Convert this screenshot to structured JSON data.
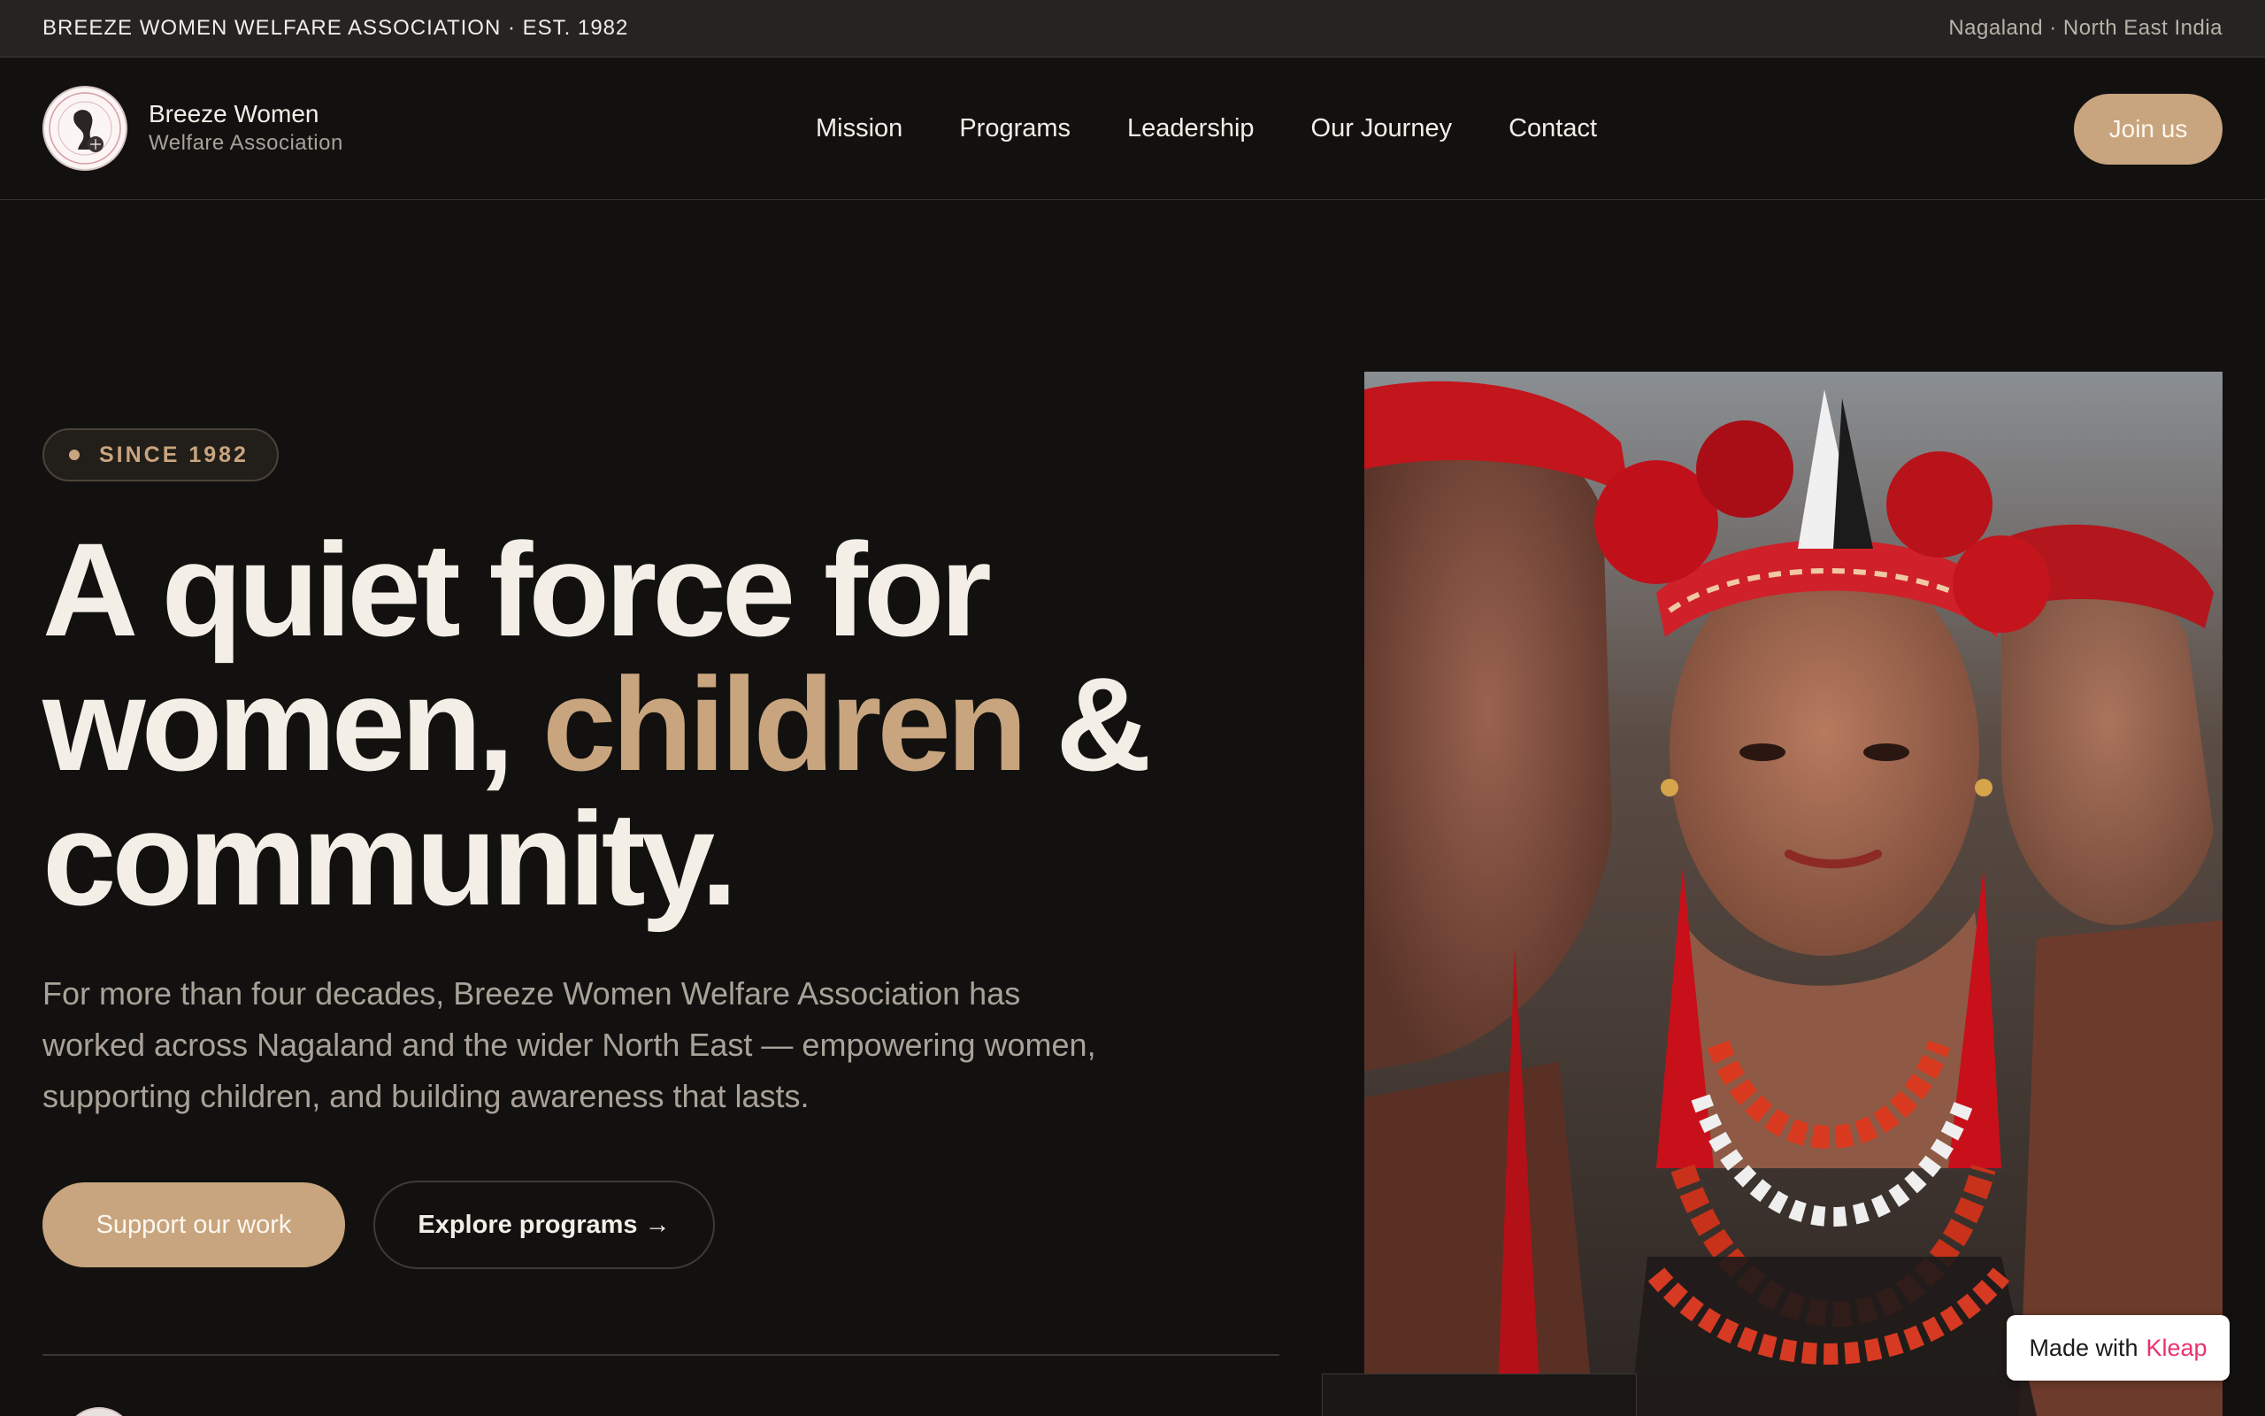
{
  "topbar": {
    "left": "BREEZE WOMEN WELFARE ASSOCIATION · EST. 1982",
    "right": "Nagaland · North East India"
  },
  "brand": {
    "name": "Breeze Women",
    "subtitle": "Welfare Association",
    "logo_icon": "association-seal-logo"
  },
  "nav": {
    "items": [
      "Mission",
      "Programs",
      "Leadership",
      "Our Journey",
      "Contact"
    ],
    "cta": "Join us"
  },
  "hero": {
    "badge": "SINCE 1982",
    "headline": {
      "line1": "A quiet force for",
      "line2_start": "women, ",
      "accent": "children",
      "line2_end": " &",
      "line3": "community."
    },
    "lead": "For more than four decades, Breeze Women Welfare Association has worked across Nagaland and the wider North East — empowering women, supporting children, and building awareness that lasts.",
    "primary_button": "Support our work",
    "secondary_button": "Explore programs →",
    "image_subject": "women in traditional Naga headdresses"
  },
  "badge_widget": {
    "prefix": "Made with",
    "brand": "Kleap"
  },
  "colors": {
    "background": "#131110",
    "accent": "#c8a57e",
    "text": "#f3eee6",
    "muted": "#a9a298",
    "kleap": "#e8326d"
  }
}
